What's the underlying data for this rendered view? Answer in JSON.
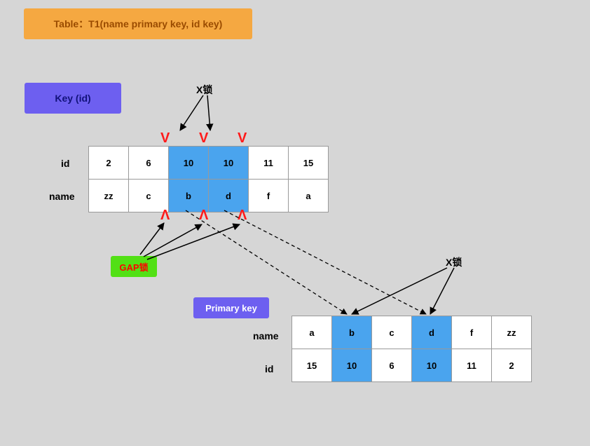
{
  "title": "Table：T1(name  primary  key, id   key)",
  "key_label": "Key  (id)",
  "primary_key_label": "Primary key",
  "xlock_label": "X锁",
  "gaplock_label": "GAP锁",
  "table1": {
    "rowhdr1": "id",
    "rowhdr2": "name",
    "r1": [
      "2",
      "6",
      "10",
      "10",
      "11",
      "15"
    ],
    "r2": [
      "zz",
      "c",
      "b",
      "d",
      "f",
      "a"
    ],
    "highlight_cols": [
      2,
      3
    ]
  },
  "table2": {
    "rowhdr1": "name",
    "rowhdr2": "id",
    "r1": [
      "a",
      "b",
      "c",
      "d",
      "f",
      "zz"
    ],
    "r2": [
      "15",
      "10",
      "6",
      "10",
      "11",
      "2"
    ],
    "highlight_cols": [
      1,
      3
    ]
  },
  "colors": {
    "orange": "#f5a841",
    "blue": "#6d5ff0",
    "green": "#52e015",
    "cellhl": "#4aa4ee",
    "red": "#ff1a1a"
  }
}
